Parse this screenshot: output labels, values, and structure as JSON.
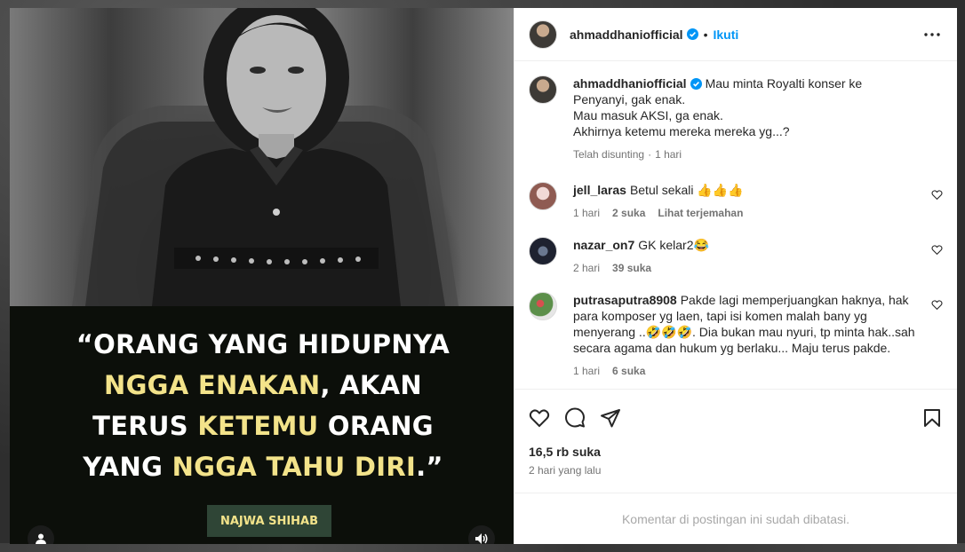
{
  "post": {
    "username": "ahmaddhaniofficial",
    "follow_label": "Ikuti",
    "caption": "Mau minta Royalti konser ke Penyanyi, gak enak.\nMau masuk AKSI, ga enak.\nAkhirnya ketemu mereka mereka yg...?",
    "caption_meta_edited": "Telah disunting",
    "caption_meta_time": "1 hari",
    "likes": "16,5 rb suka",
    "time_ago": "2 hari yang lalu",
    "comments_limited": "Komentar di postingan ini sudah dibatasi."
  },
  "media": {
    "quote_line1": "“ORANG YANG HIDUPNYA",
    "quote_line2_hl": "NGGA ENAKAN",
    "quote_line2_rest": ", AKAN",
    "quote_line3_a": "TERUS ",
    "quote_line3_hl": "KETEMU",
    "quote_line3_b": " ORANG",
    "quote_line4_a": "YANG ",
    "quote_line4_hl": "NGGA TAHU DIRI",
    "quote_line4_b": ".”",
    "author": "NAJWA SHIHAB"
  },
  "comments": [
    {
      "username": "jell_laras",
      "text": "Betul sekali 👍👍👍",
      "time": "1 hari",
      "likes": "2 suka",
      "translate": "Lihat terjemahan"
    },
    {
      "username": "nazar_on7",
      "text": "GK kelar2😂",
      "time": "2 hari",
      "likes": "39 suka"
    },
    {
      "username": "putrasaputra8908",
      "text": "Pakde lagi memperjuangkan haknya, hak para komposer yg laen, tapi isi komen malah bany yg menyerang ..🤣🤣🤣. Dia bukan mau nyuri, tp minta hak..sah secara agama dan hukum yg berlaku... Maju terus pakde.",
      "time": "1 hari",
      "likes": "6 suka"
    }
  ],
  "icons": {
    "like": "heart-icon",
    "comment": "comment-icon",
    "share": "share-icon",
    "save": "bookmark-icon",
    "more": "more-icon",
    "verified": "verified-badge-icon",
    "user": "user-tag-icon",
    "sound": "sound-icon"
  },
  "colors": {
    "link": "#0095f6",
    "highlight": "#f3e38a",
    "badge": "#2f4536"
  }
}
